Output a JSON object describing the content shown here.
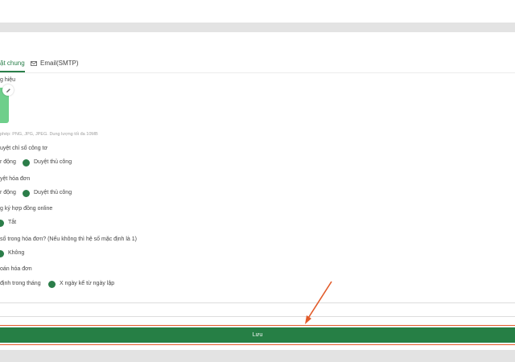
{
  "tabs": [
    {
      "label": "ặt chung",
      "active": true
    },
    {
      "label": "Email(SMTP)",
      "active": false,
      "icon": "mail-icon"
    }
  ],
  "brand": {
    "label": "g hiệu",
    "hint": "phép: PNG, JPG, JPEG. Dung lượng tối đa 10MB",
    "logo_color": "#6fcf8b"
  },
  "meter_approval": {
    "label": "uyệt chỉ số công tơ",
    "options": [
      "r động",
      "Duyệt thủ công"
    ]
  },
  "invoice_approval": {
    "label": "yệt hóa đơn",
    "options": [
      "r động",
      "Duyệt thủ công"
    ]
  },
  "online_contract": {
    "label": "g ký hợp đồng online",
    "options": [
      "Tắt"
    ]
  },
  "invoice_number": {
    "label": "số trong hóa đơn? (Nếu không thì hệ số mặc định là 1)",
    "options": [
      "Không"
    ]
  },
  "invoice_due": {
    "label": "oán hóa đơn",
    "options": [
      "định trong tháng",
      "X ngày kể từ ngày lập"
    ]
  },
  "save_button": {
    "label": "Lưu"
  },
  "colors": {
    "accent": "#267f45",
    "radio": "#2b7d49",
    "annotation": "#e25b2a"
  }
}
